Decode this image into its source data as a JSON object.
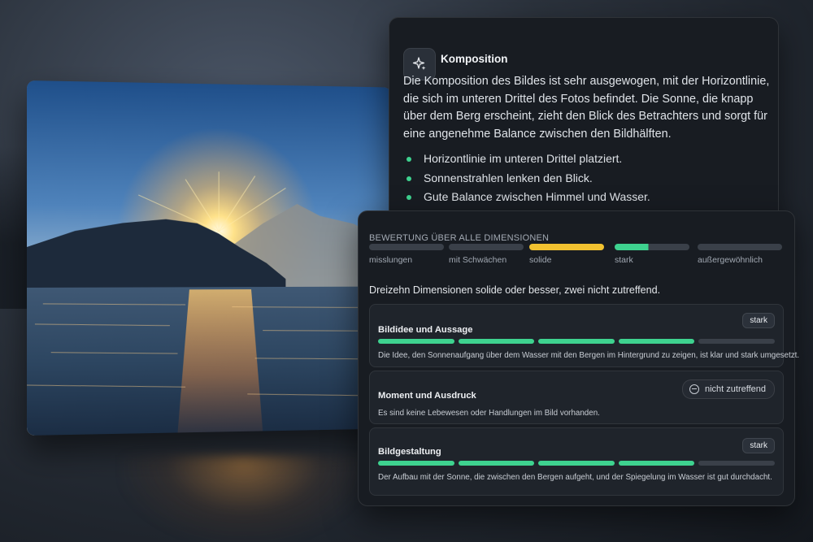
{
  "photo": {
    "alt": "Sonnenaufgang über Bergen und Wasser"
  },
  "composition": {
    "title": "Komposition",
    "icon": "sparkle-icon",
    "text": "Die Komposition des Bildes ist sehr ausgewogen, mit der Horizontlinie, die sich im unteren Drittel des Fotos befindet. Die Sonne, die knapp über dem Berg erscheint, zieht den Blick des Betrachters und sorgt für eine angenehme Balance zwischen den Bildhälften.",
    "bullets": [
      "Horizontlinie im unteren Drittel platziert.",
      "Sonnenstrahlen lenken den Blick.",
      "Gute Balance zwischen Himmel und Wasser."
    ],
    "bullet_color": "#3ed28f"
  },
  "evaluation": {
    "heading": "BEWERTUNG ÜBER ALLE DIMENSIONEN",
    "scale": [
      {
        "label": "misslungen",
        "fill": 0,
        "color": "#3a4049"
      },
      {
        "label": "mit Schwächen",
        "fill": 0,
        "color": "#3a4049"
      },
      {
        "label": "solide",
        "fill": 1,
        "color": "#f2c230"
      },
      {
        "label": "stark",
        "fill": 0.45,
        "color": "#3ed28f"
      },
      {
        "label": "außergewöhnlich",
        "fill": 0,
        "color": "#3a4049"
      }
    ],
    "summary": "Dreizehn Dimensionen solide oder besser, zwei nicht zutreffend.",
    "dimensions": [
      {
        "title": "Bildidee und Aussage",
        "badge": "stark",
        "filled_segments": 4,
        "description": "Die Idee, den Sonnenaufgang über dem Wasser mit den Bergen im Hintergrund zu zeigen, ist klar und stark umgesetzt."
      },
      {
        "title": "Moment und Ausdruck",
        "badge": "nicht zutreffend",
        "filled_segments": 0,
        "description": "Es sind keine Lebewesen oder Handlungen im Bild vorhanden."
      },
      {
        "title": "Bildgestaltung",
        "badge": "stark",
        "filled_segments": 4,
        "description": "Der Aufbau mit der Sonne, die zwischen den Bergen aufgeht, und der Spiegelung im Wasser ist gut durchdacht."
      }
    ],
    "accent_color": "#3ed28f",
    "empty_color": "#3a4049"
  }
}
